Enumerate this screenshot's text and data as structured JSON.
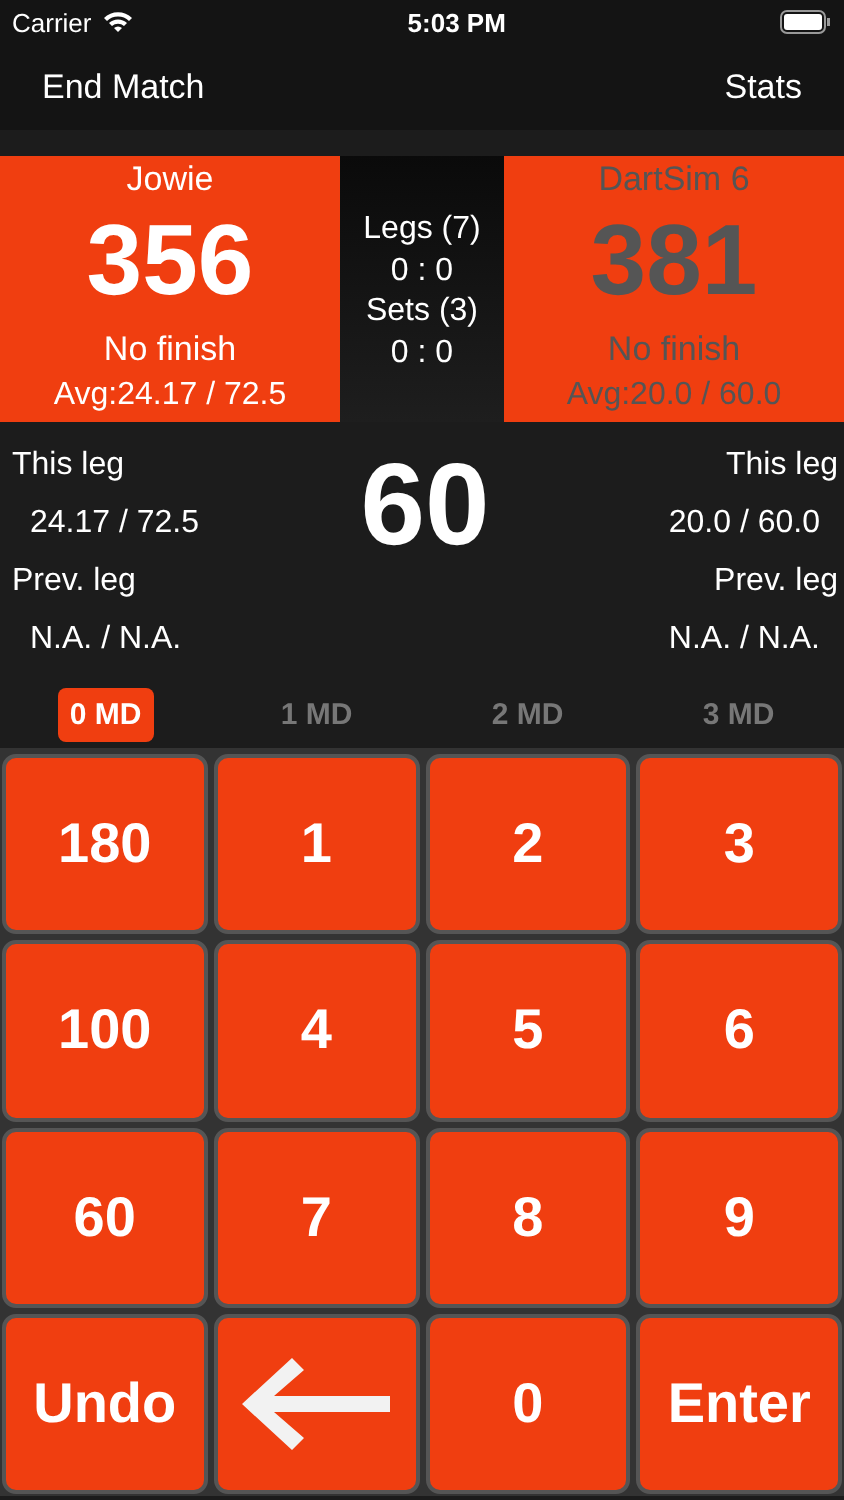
{
  "status_bar": {
    "carrier": "Carrier",
    "time": "5:03 PM"
  },
  "nav": {
    "left": "End Match",
    "right": "Stats"
  },
  "players": [
    {
      "name": "Jowie",
      "score": "356",
      "finish": "No finish",
      "avg": "Avg:24.17 / 72.5",
      "active": true
    },
    {
      "name": "DartSim 6",
      "score": "381",
      "finish": "No finish",
      "avg": "Avg:20.0 / 60.0",
      "active": false
    }
  ],
  "match": {
    "legs_label": "Legs (7)",
    "legs_score": "0 : 0",
    "sets_label": "Sets (3)",
    "sets_score": "0 : 0"
  },
  "leg_stats": [
    {
      "this_label": "This leg",
      "this_value": "24.17 / 72.5",
      "prev_label": "Prev. leg",
      "prev_value": "N.A. / N.A."
    },
    {
      "this_label": "This leg",
      "this_value": "20.0 / 60.0",
      "prev_label": "Prev. leg",
      "prev_value": "N.A. / N.A."
    }
  ],
  "current_score": "60",
  "md_options": [
    {
      "label": "0 MD",
      "selected": true
    },
    {
      "label": "1 MD",
      "selected": false
    },
    {
      "label": "2 MD",
      "selected": false
    },
    {
      "label": "3 MD",
      "selected": false
    }
  ],
  "keys": [
    {
      "kind": "text",
      "label": "180"
    },
    {
      "kind": "text",
      "label": "1"
    },
    {
      "kind": "text",
      "label": "2"
    },
    {
      "kind": "text",
      "label": "3"
    },
    {
      "kind": "text",
      "label": "100"
    },
    {
      "kind": "text",
      "label": "4"
    },
    {
      "kind": "text",
      "label": "5"
    },
    {
      "kind": "text",
      "label": "6"
    },
    {
      "kind": "text",
      "label": "60"
    },
    {
      "kind": "text",
      "label": "7"
    },
    {
      "kind": "text",
      "label": "8"
    },
    {
      "kind": "text",
      "label": "9"
    },
    {
      "kind": "text",
      "label": "Undo"
    },
    {
      "kind": "backspace"
    },
    {
      "kind": "text",
      "label": "0"
    },
    {
      "kind": "text",
      "label": "Enter"
    }
  ]
}
